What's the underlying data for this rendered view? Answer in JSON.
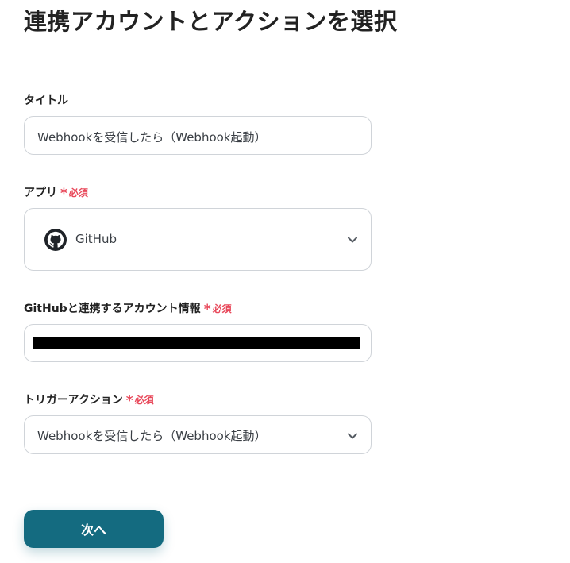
{
  "page": {
    "title": "連携アカウントとアクションを選択"
  },
  "fields": {
    "title": {
      "label": "タイトル",
      "value": "Webhookを受信したら（Webhook起動）"
    },
    "app": {
      "label": "アプリ",
      "required_text": "必須",
      "value": "GitHub",
      "icon": "github-icon"
    },
    "account": {
      "label": "GitHubと連携するアカウント情報",
      "required_text": "必須"
    },
    "trigger": {
      "label": "トリガーアクション",
      "required_text": "必須",
      "value": "Webhookを受信したら（Webhook起動）"
    }
  },
  "actions": {
    "next_label": "次へ"
  },
  "colors": {
    "accent": "#146b80",
    "required": "#e8485a",
    "border": "#d0d4d9"
  }
}
